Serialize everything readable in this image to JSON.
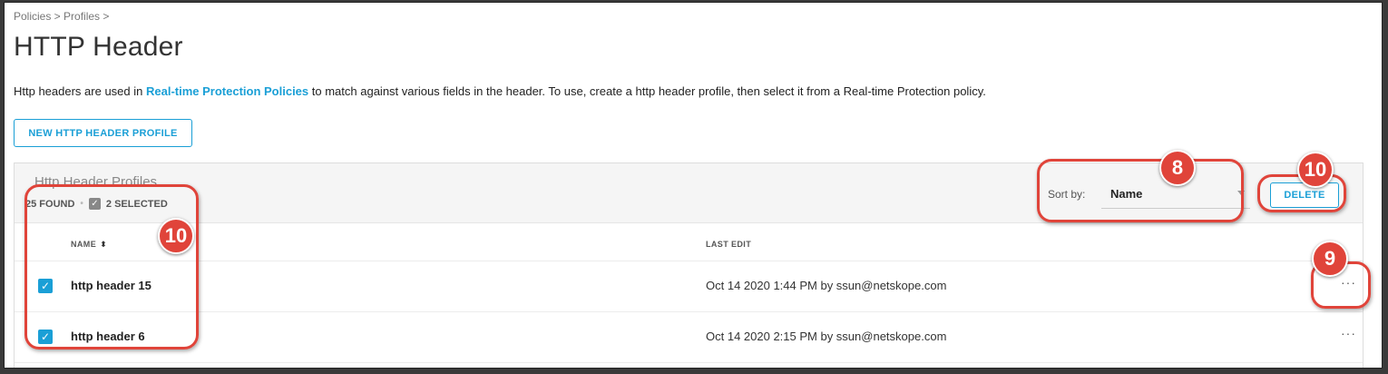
{
  "breadcrumb": "Policies > Profiles >",
  "page_title": "HTTP Header",
  "description": {
    "prefix": "Http headers are used in ",
    "link": "Real-time Protection Policies",
    "suffix": " to match against various fields in the header. To use, create a http header profile, then select it from a Real-time Protection policy."
  },
  "new_button_label": "NEW HTTP HEADER PROFILE",
  "panel": {
    "title": "Http Header Profiles",
    "found": "25 FOUND",
    "selected": "2 SELECTED",
    "sort_label": "Sort by:",
    "sort_value": "Name",
    "delete_label": "DELETE"
  },
  "columns": {
    "name": "NAME",
    "last_edit": "LAST EDIT"
  },
  "rows": [
    {
      "name": "http header 15",
      "last_edit": "Oct 14 2020 1:44 PM by ssun@netskope.com",
      "checked": true,
      "more": "···"
    },
    {
      "name": "http header 6",
      "last_edit": "Oct 14 2020 2:15 PM by ssun@netskope.com",
      "checked": true,
      "more": "···"
    }
  ],
  "callouts": {
    "sort": "8",
    "more": "9",
    "delete": "10",
    "selection": "10"
  },
  "colors": {
    "accent": "#1a9fd6",
    "callout": "#e0443a"
  },
  "icons": {
    "check": "checkmark-icon",
    "sort": "sort-arrows-icon",
    "more": "ellipsis-icon",
    "caret": "caret-down-icon"
  }
}
